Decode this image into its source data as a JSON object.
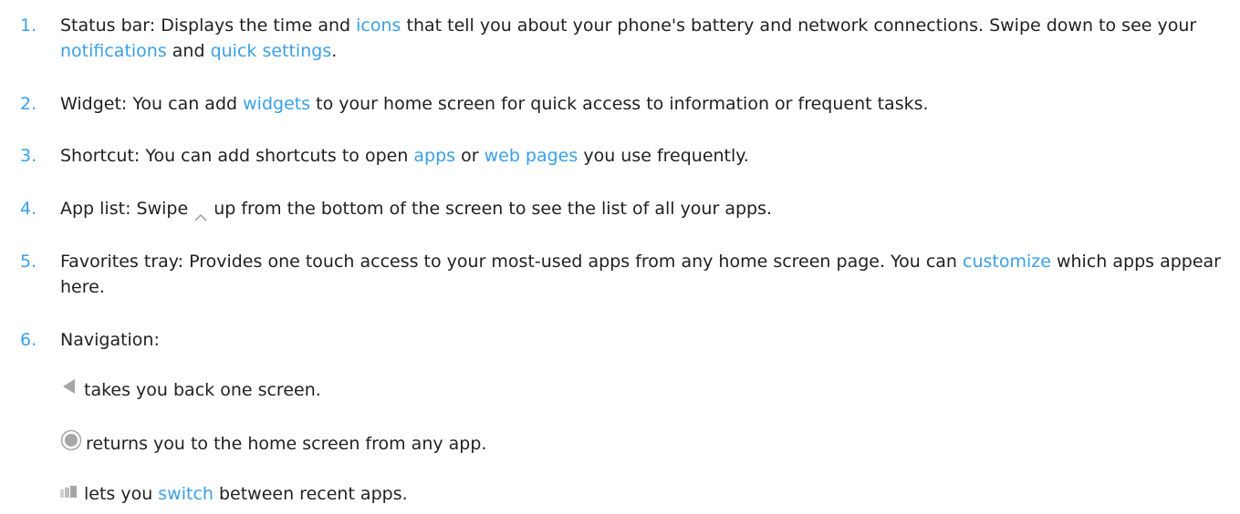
{
  "colors": {
    "link": "#3aa0e8",
    "text": "#212121",
    "icon_gray": "#a6a6a6"
  },
  "items": [
    {
      "num": "1.",
      "label": "Status bar:",
      "t1": " Displays the time and ",
      "l1": "icons",
      "t2": " that tell you about your phone's battery and network connections. Swipe down to see your ",
      "l2": "notifications",
      "t3": " and ",
      "l3": "quick settings",
      "t4": "."
    },
    {
      "num": "2.",
      "label": "Widget:",
      "t1": " You can add ",
      "l1": "widgets",
      "t2": " to your home screen for quick access to information or frequent tasks."
    },
    {
      "num": "3.",
      "label": "Shortcut:",
      "t1": " You can add shortcuts to open ",
      "l1": "apps",
      "t2": " or ",
      "l2": "web pages",
      "t3": " you use frequently."
    },
    {
      "num": "4.",
      "label": "App list:",
      "t1": " Swipe ",
      "icon": "chevron-up-icon",
      "t2": " up from the bottom of the screen to see the list of all your apps."
    },
    {
      "num": "5.",
      "label": "Favorites tray:",
      "t1": " Provides one touch access to your most-used apps from any home screen page. You can ",
      "l1": "customize",
      "t2": " which apps appear here."
    },
    {
      "num": "6.",
      "label": "Navigation:"
    }
  ],
  "navigation": [
    {
      "icon": "back-triangle-icon",
      "text": "takes you back one screen."
    },
    {
      "icon": "home-circle-icon",
      "text": "returns you to the home screen from any app."
    },
    {
      "icon": "recent-apps-icon",
      "t1": "lets you ",
      "l1": "switch",
      "t2": " between recent apps."
    }
  ]
}
